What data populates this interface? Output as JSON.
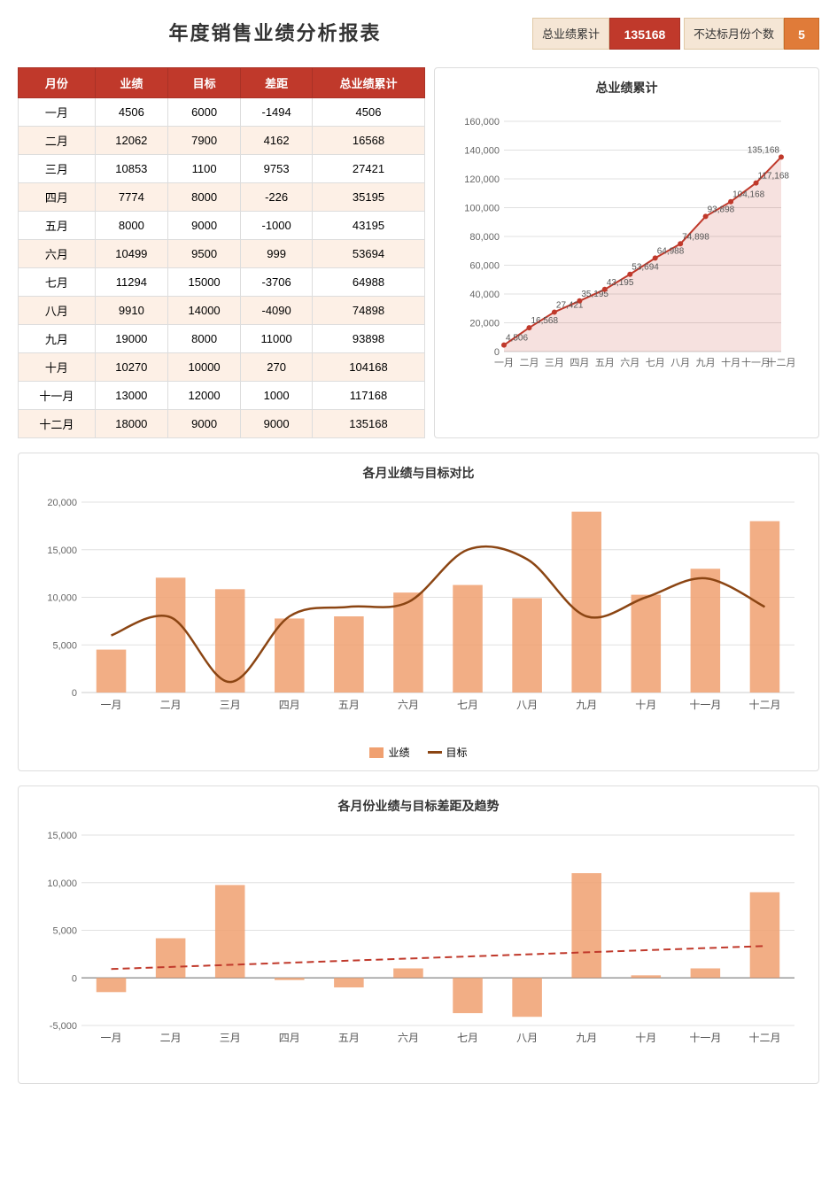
{
  "title": "年度销售业绩分析报表",
  "stats": {
    "total_label": "总业绩累计",
    "total_value": "135168",
    "below_label": "不达标月份个数",
    "below_value": "5"
  },
  "table": {
    "headers": [
      "月份",
      "业绩",
      "目标",
      "差距",
      "总业绩累计"
    ],
    "rows": [
      [
        "一月",
        "4506",
        "6000",
        "-1494",
        "4506"
      ],
      [
        "二月",
        "12062",
        "7900",
        "4162",
        "16568"
      ],
      [
        "三月",
        "10853",
        "1100",
        "9753",
        "27421"
      ],
      [
        "四月",
        "7774",
        "8000",
        "-226",
        "35195"
      ],
      [
        "五月",
        "8000",
        "9000",
        "-1000",
        "43195"
      ],
      [
        "六月",
        "10499",
        "9500",
        "999",
        "53694"
      ],
      [
        "七月",
        "11294",
        "15000",
        "-3706",
        "64988"
      ],
      [
        "八月",
        "9910",
        "14000",
        "-4090",
        "74898"
      ],
      [
        "九月",
        "19000",
        "8000",
        "11000",
        "93898"
      ],
      [
        "十月",
        "10270",
        "10000",
        "270",
        "104168"
      ],
      [
        "十一月",
        "13000",
        "12000",
        "1000",
        "117168"
      ],
      [
        "十二月",
        "18000",
        "9000",
        "9000",
        "135168"
      ]
    ]
  },
  "chart1": {
    "title": "总业绩累计",
    "y_labels": [
      "0",
      "20000",
      "40000",
      "60000",
      "80000",
      "100000",
      "120000",
      "140000",
      "160000"
    ],
    "data": [
      4506,
      16568,
      27421,
      35195,
      43195,
      53694,
      64988,
      74898,
      93898,
      104168,
      117168,
      135168
    ],
    "x_labels": [
      "一月",
      "二月",
      "三月",
      "四月",
      "五月",
      "六月",
      "七月",
      "八月",
      "九月",
      "十月",
      "十一月",
      "十二月"
    ]
  },
  "chart2": {
    "title": "各月业绩与目标对比",
    "y_labels": [
      "0",
      "5000",
      "10000",
      "15000",
      "20000"
    ],
    "performance": [
      4506,
      12062,
      10853,
      7774,
      8000,
      10499,
      11294,
      9910,
      19000,
      10270,
      13000,
      18000
    ],
    "target": [
      6000,
      7900,
      1100,
      8000,
      9000,
      9500,
      15000,
      14000,
      8000,
      10000,
      12000,
      9000
    ],
    "x_labels": [
      "一月",
      "二月",
      "三月",
      "四月",
      "五月",
      "六月",
      "七月",
      "八月",
      "九月",
      "十月",
      "十一月",
      "十二月"
    ],
    "legend": {
      "bar_label": "业绩",
      "line_label": "目标"
    }
  },
  "chart3": {
    "title": "各月份业绩与目标差距及趋势",
    "y_labels": [
      "-5000",
      "0",
      "5000",
      "10000",
      "15000"
    ],
    "diff": [
      -1494,
      4162,
      9753,
      -226,
      -1000,
      999,
      -3706,
      -4090,
      11000,
      270,
      1000,
      9000
    ],
    "x_labels": [
      "一月",
      "二月",
      "三月",
      "四月",
      "五月",
      "六月",
      "七月",
      "八月",
      "九月",
      "十月",
      "十一月",
      "十二月"
    ]
  }
}
